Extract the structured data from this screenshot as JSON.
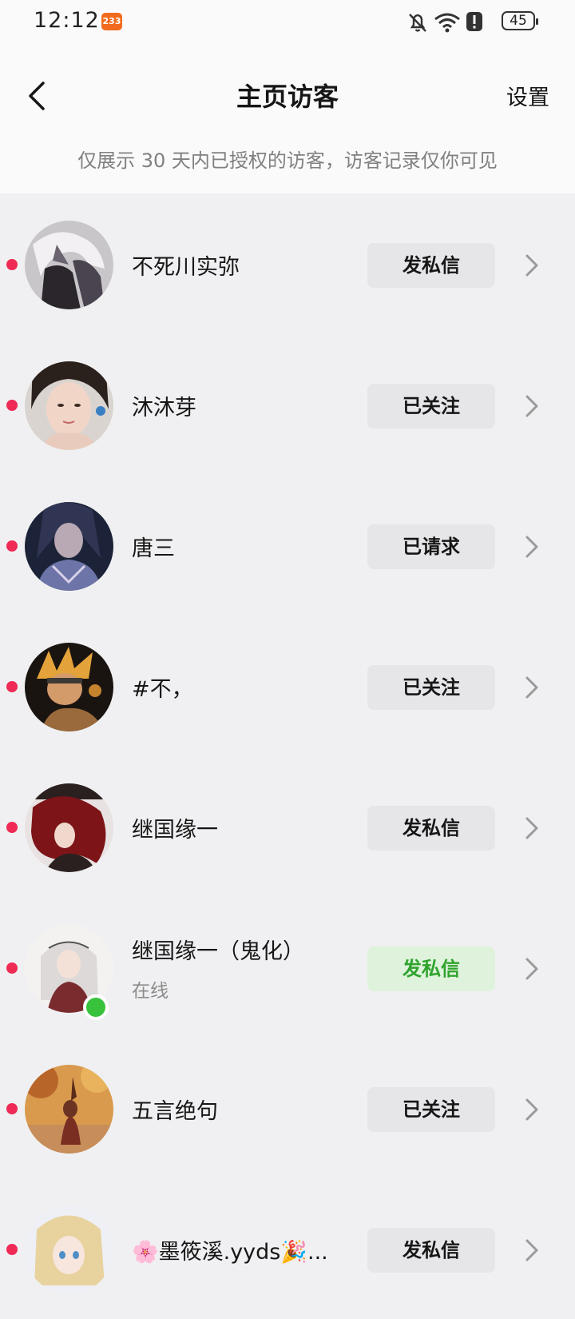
{
  "status_bar": {
    "time": "12:12",
    "app_badge": "233",
    "battery": "45"
  },
  "header": {
    "title": "主页访客",
    "settings_label": "设置",
    "notice": "仅展示 30 天内已授权的访客，访客记录仅你可见"
  },
  "visitors": [
    {
      "name": "不死川实弥",
      "status": "",
      "action": "发私信",
      "online": false,
      "action_style": "default"
    },
    {
      "name": "沐沐芽",
      "status": "",
      "action": "已关注",
      "online": false,
      "action_style": "default"
    },
    {
      "name": "唐三",
      "status": "",
      "action": "已请求",
      "online": false,
      "action_style": "default"
    },
    {
      "name": "#不，",
      "status": "",
      "action": "已关注",
      "online": false,
      "action_style": "default"
    },
    {
      "name": "继国缘一",
      "status": "",
      "action": "发私信",
      "online": false,
      "action_style": "default"
    },
    {
      "name": "继国缘一（鬼化）",
      "status": "在线",
      "action": "发私信",
      "online": true,
      "action_style": "green"
    },
    {
      "name": "五言绝句",
      "status": "",
      "action": "已关注",
      "online": false,
      "action_style": "default"
    },
    {
      "name": "🌸墨筱溪.yyds🎉...",
      "status": "",
      "action": "发私信",
      "online": false,
      "action_style": "default"
    }
  ],
  "colors": {
    "unread_dot": "#ee2a55",
    "online_green": "#39c23b",
    "green_button_bg": "#dff3dc",
    "green_button_text": "#2fa32d",
    "button_bg": "#e6e6e9"
  },
  "icons": {
    "back": "chevron-left-icon",
    "row_arrow": "chevron-right-icon",
    "mute": "bell-slash-icon",
    "wifi": "wifi-icon",
    "alert": "alert-icon",
    "battery": "battery-icon"
  }
}
